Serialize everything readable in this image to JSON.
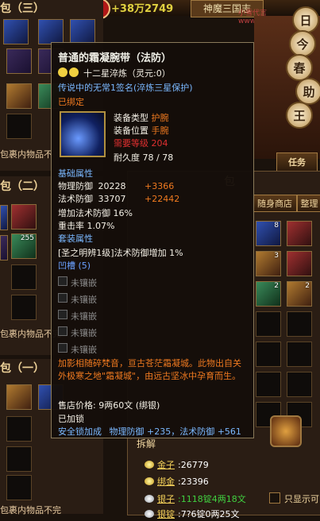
{
  "bags": {
    "bag3_title": "包（三）",
    "bag2_title": "包（二）",
    "bag1_title": "包（一）",
    "hint": "包裹内物品不完",
    "hint_short": "包裹内物品不",
    "slot_counts": [
      "255",
      "8",
      "3",
      "2",
      "2"
    ]
  },
  "header": {
    "money_text": "+38万2749",
    "game_title": "神魔三国志",
    "watermark": "小雪代言www.xxds77.com"
  },
  "side_buttons": [
    "日",
    "今",
    "春",
    "助",
    "王"
  ],
  "task_button": "任务",
  "inventory": {
    "title": "包",
    "shop_tab": "随身商店",
    "sort_button": "整理",
    "disassemble": "拆解",
    "money": [
      {
        "label": "金子",
        "value": ":26779"
      },
      {
        "label": "绑金",
        "value": ":23396"
      },
      {
        "label": "银子",
        "value": ":1118锭4两18文"
      },
      {
        "label": "银锭",
        "value": ":7?6锭0两25文"
      }
    ],
    "show_only": "只显示可"
  },
  "tooltip": {
    "name": "普通的霜凝腕带（法防）",
    "refine": "十二星淬炼（灵元:0）",
    "legend": "传说中的无常1签名(淬炼三星保护)",
    "bound": "已绑定",
    "type_label": "装备类型",
    "type_value": "护腕",
    "pos_label": "装备位置",
    "pos_value": "手腕",
    "level_label": "需要等级",
    "level_value": "204",
    "dur_label": "耐久度",
    "dur_value": "78 / 78",
    "base_title": "基础属性",
    "attrs": [
      {
        "name": "物理防御",
        "base": "20228",
        "bonus": "+3366"
      },
      {
        "name": "法术防御",
        "base": "33707",
        "bonus": "+22442"
      }
    ],
    "attr3": "增加法术防御 16%",
    "attr4": "重击率    1.07%",
    "set_title": "套装属性",
    "set_line": "[圣之明辨1级]法术防御增加 1%",
    "socket_title": "凹槽 (5)",
    "socket_label": "未镶嵌",
    "desc": "加影相随碎梵音，亘古苍茫霜凝城。此物出自关外极寒之地\"霜凝城\"，由远古坚冰中孕育而生。",
    "price_label": "售店价格:",
    "price_value": "9两60文",
    "price_note": "(绑银)",
    "locked": "已加锁",
    "safe": "安全锁加成",
    "safe_bonus": "物理防御 +235，法术防御 +561"
  }
}
